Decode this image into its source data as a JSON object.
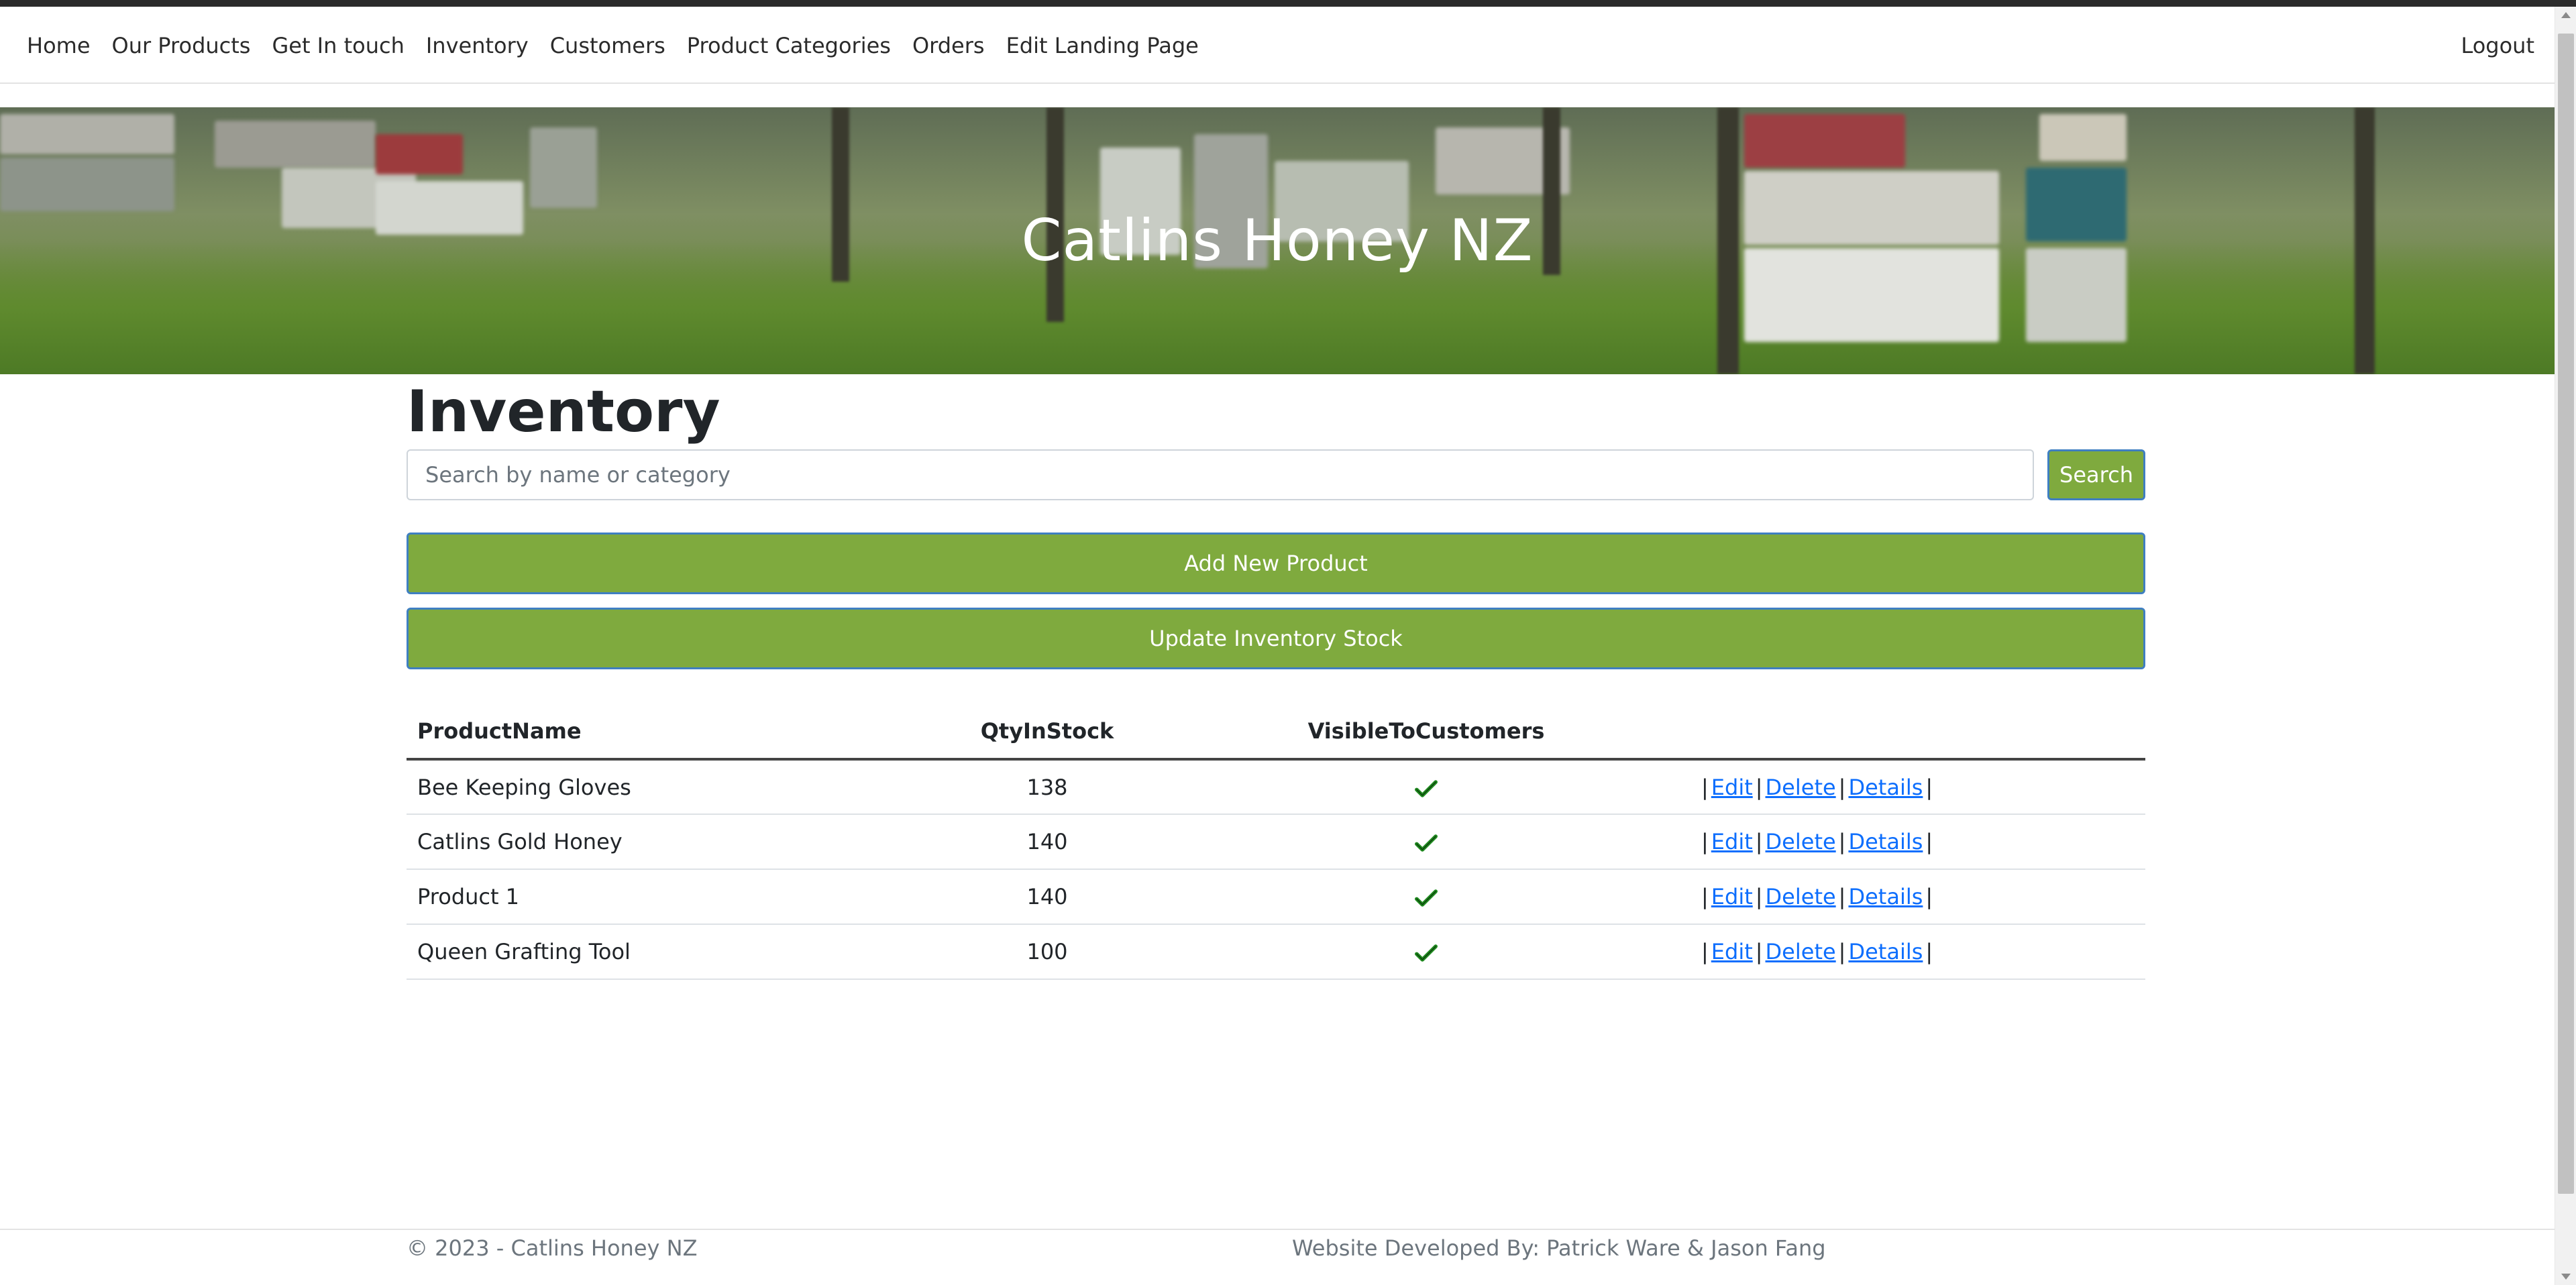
{
  "nav": {
    "links": [
      "Home",
      "Our Products",
      "Get In touch",
      "Inventory",
      "Customers",
      "Product Categories",
      "Orders",
      "Edit Landing Page"
    ],
    "logout": "Logout"
  },
  "hero": {
    "title": "Catlins Honey NZ"
  },
  "inventory": {
    "title": "Inventory",
    "search_placeholder": "Search by name or category",
    "search_button": "Search",
    "add_button": "Add New Product",
    "update_button": "Update Inventory Stock",
    "columns": [
      "ProductName",
      "QtyInStock",
      "VisibleToCustomers"
    ],
    "rows": [
      {
        "name": "Bee Keeping Gloves",
        "qty": "138",
        "visible": true
      },
      {
        "name": "Catlins Gold Honey",
        "qty": "140",
        "visible": true
      },
      {
        "name": "Product 1",
        "qty": "140",
        "visible": true
      },
      {
        "name": "Queen Grafting Tool",
        "qty": "100",
        "visible": true
      }
    ],
    "actions": {
      "edit": "Edit",
      "delete": "Delete",
      "details": "Details",
      "separator": "|"
    }
  },
  "footer": {
    "copyright": "© 2023 - Catlins Honey NZ",
    "developers": "Website Developed By: Patrick Ware & Jason Fang"
  },
  "colors": {
    "button_green": "#7faa3e",
    "button_border": "#3f7fc1",
    "link_blue": "#0d6efd",
    "check_green": "#1f8a1f"
  },
  "icons": {
    "visible": "check-icon"
  }
}
